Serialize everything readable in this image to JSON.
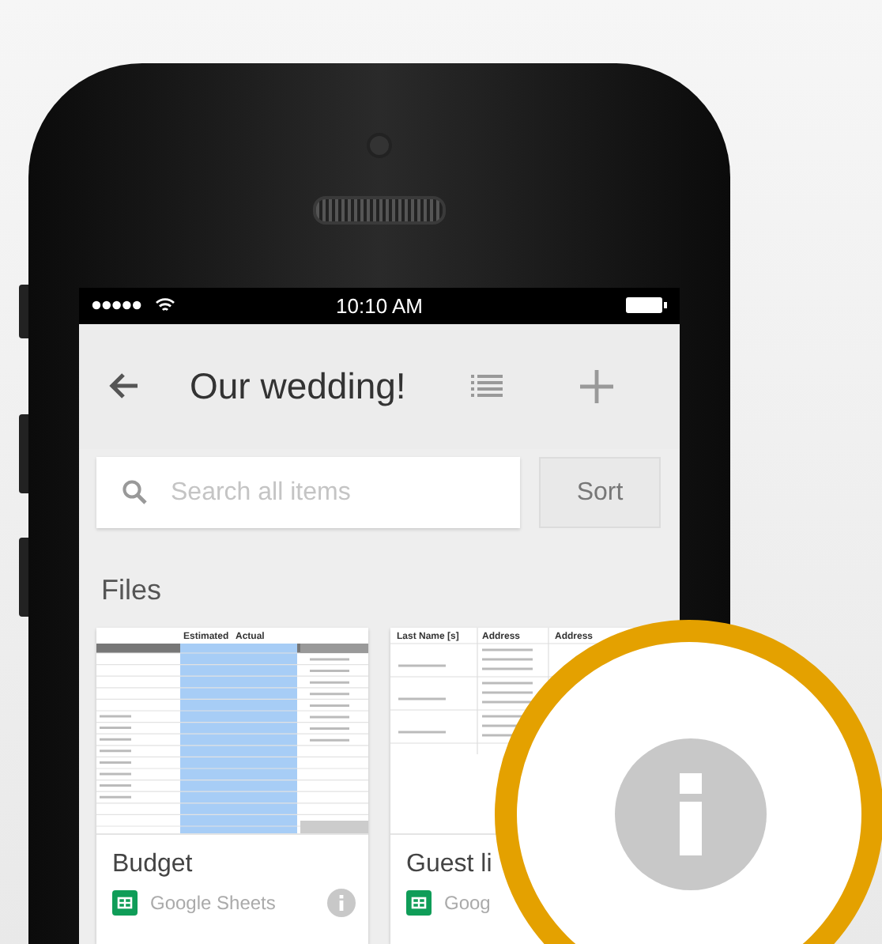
{
  "status_bar": {
    "time": "10:10 AM"
  },
  "app_bar": {
    "title": "Our wedding!"
  },
  "search": {
    "placeholder": "Search all items"
  },
  "sort_button": {
    "label": "Sort"
  },
  "section_title": "Files",
  "files": [
    {
      "name": "Budget",
      "app": "Google Sheets",
      "preview": {
        "kind": "budget",
        "headers": [
          "Estimated",
          "Actual"
        ]
      }
    },
    {
      "name": "Guest li",
      "app": "Goog",
      "preview": {
        "kind": "guests",
        "headers": [
          "Last Name [s]",
          "Address",
          "Address"
        ]
      }
    }
  ]
}
